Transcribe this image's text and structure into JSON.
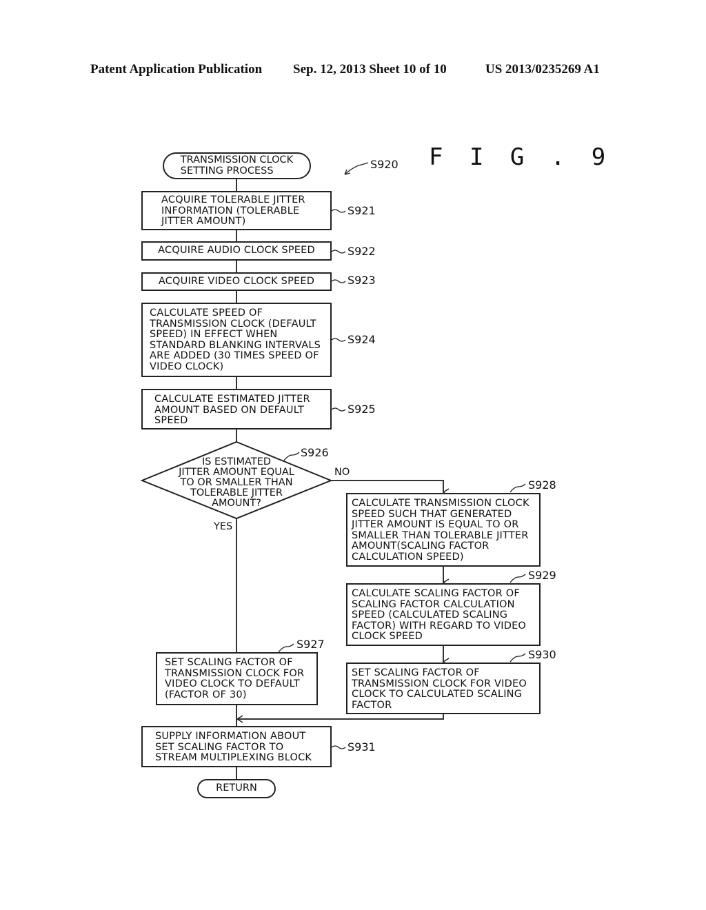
{
  "header": {
    "publication": "Patent Application Publication",
    "date_sheet": "Sep. 12, 2013   Sheet 10 of 10",
    "number": "US 2013/0235269 A1"
  },
  "figure_label": "F I G . 9",
  "flowchart": {
    "start": {
      "id": "S920",
      "text": "TRANSMISSION CLOCK\nSETTING PROCESS"
    },
    "steps": [
      {
        "id": "S921",
        "text": "ACQUIRE TOLERABLE JITTER\nINFORMATION (TOLERABLE\nJITTER AMOUNT)"
      },
      {
        "id": "S922",
        "text": "ACQUIRE AUDIO CLOCK SPEED"
      },
      {
        "id": "S923",
        "text": "ACQUIRE VIDEO CLOCK SPEED"
      },
      {
        "id": "S924",
        "text": "CALCULATE SPEED OF\nTRANSMISSION CLOCK (DEFAULT\nSPEED) IN EFFECT WHEN\nSTANDARD BLANKING INTERVALS\nARE ADDED (30 TIMES SPEED OF\nVIDEO CLOCK)"
      },
      {
        "id": "S925",
        "text": "CALCULATE ESTIMATED JITTER\nAMOUNT BASED ON DEFAULT\nSPEED"
      },
      {
        "id": "S927",
        "text": "SET SCALING FACTOR OF\nTRANSMISSION CLOCK FOR\nVIDEO CLOCK TO DEFAULT\n(FACTOR OF 30)"
      },
      {
        "id": "S928",
        "text": "CALCULATE TRANSMISSION CLOCK\nSPEED SUCH THAT GENERATED\nJITTER AMOUNT IS EQUAL TO OR\nSMALLER THAN TOLERABLE JITTER\nAMOUNT(SCALING FACTOR\nCALCULATION SPEED)"
      },
      {
        "id": "S929",
        "text": "CALCULATE SCALING FACTOR OF\nSCALING FACTOR CALCULATION\nSPEED (CALCULATED SCALING\nFACTOR) WITH REGARD TO VIDEO\nCLOCK SPEED"
      },
      {
        "id": "S930",
        "text": "SET SCALING FACTOR OF\nTRANSMISSION CLOCK FOR VIDEO\nCLOCK TO CALCULATED SCALING\nFACTOR"
      },
      {
        "id": "S931",
        "text": "SUPPLY INFORMATION ABOUT\nSET SCALING FACTOR TO\nSTREAM MULTIPLEXING BLOCK"
      }
    ],
    "decision": {
      "id": "S926",
      "text": "IS ESTIMATED\nJITTER AMOUNT EQUAL\nTO OR SMALLER THAN\nTOLERABLE JITTER\nAMOUNT?",
      "yes_label": "YES",
      "no_label": "NO"
    },
    "end": {
      "text": "RETURN"
    }
  }
}
